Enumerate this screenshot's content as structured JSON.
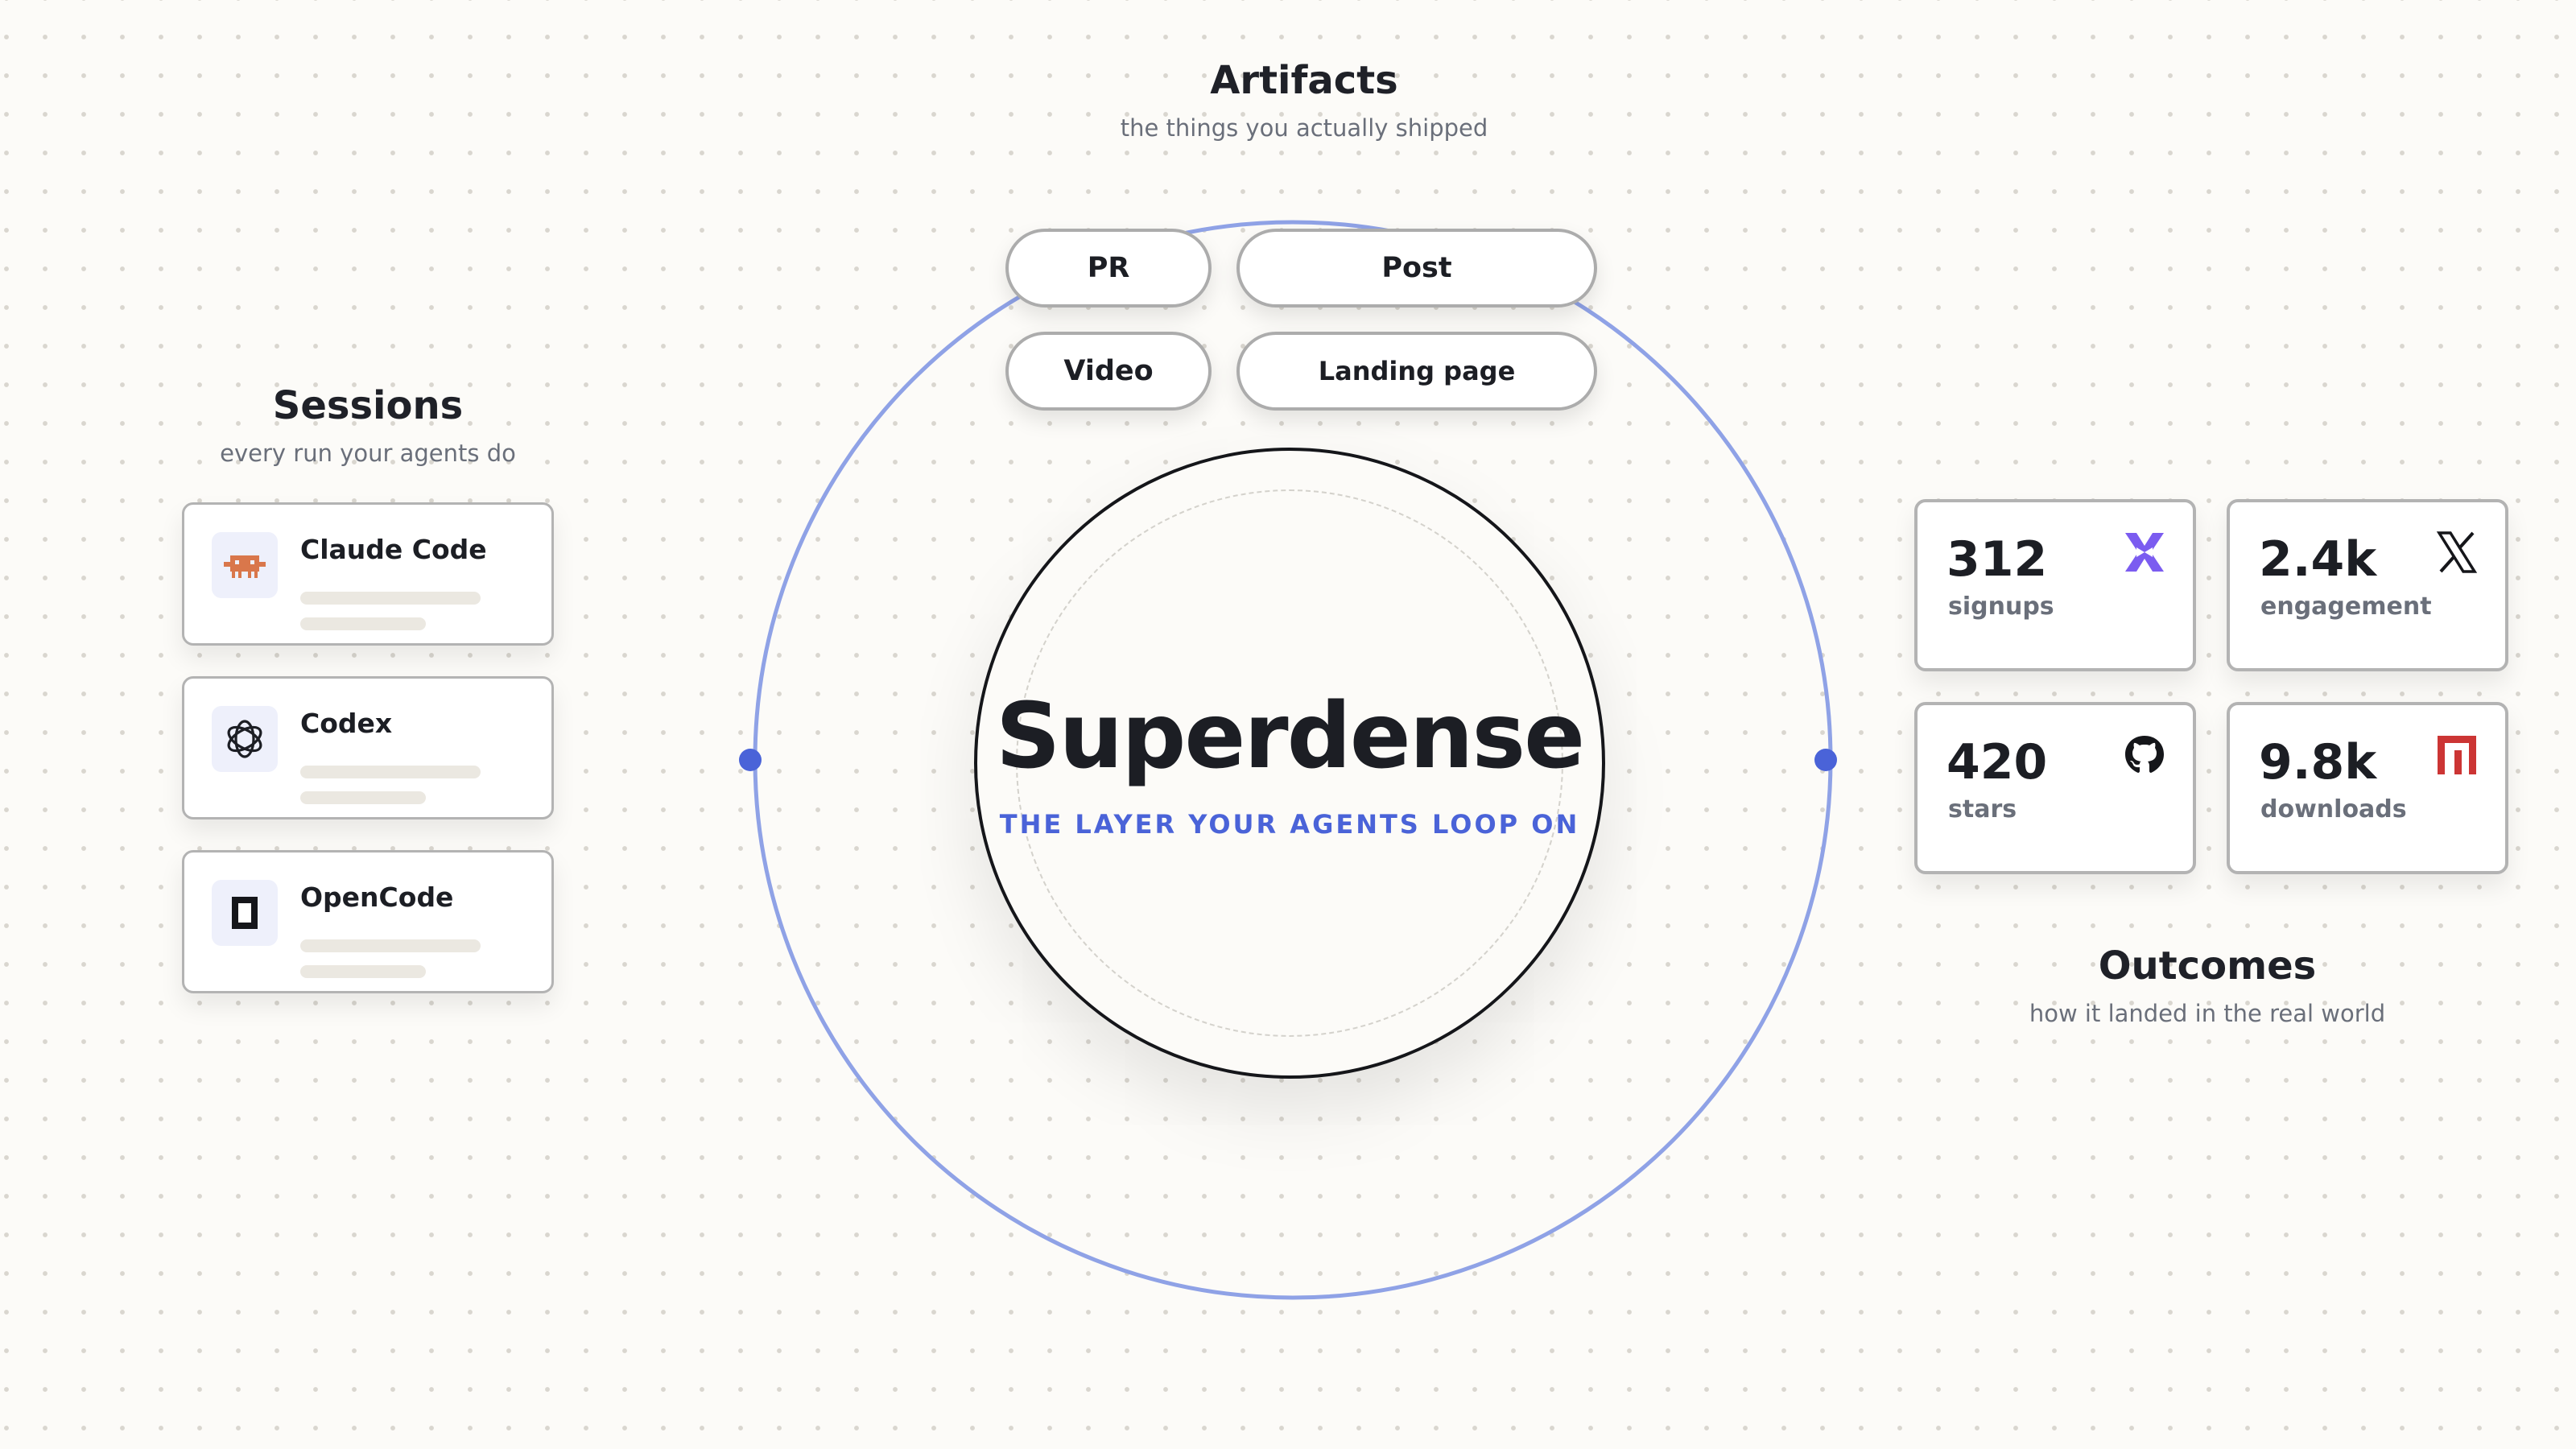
{
  "artifacts": {
    "title": "Artifacts",
    "subtitle": "the things you actually shipped",
    "items": [
      "PR",
      "Post",
      "Video",
      "Landing page"
    ]
  },
  "sessions": {
    "title": "Sessions",
    "subtitle": "every run your agents do",
    "items": [
      {
        "name": "Claude Code",
        "icon": "claude-code-icon"
      },
      {
        "name": "Codex",
        "icon": "openai-icon"
      },
      {
        "name": "OpenCode",
        "icon": "opencode-icon"
      }
    ]
  },
  "center": {
    "brand": "Superdense",
    "tagline": "THE LAYER YOUR AGENTS LOOP ON"
  },
  "outcomes": {
    "title": "Outcomes",
    "subtitle": "how it landed in the real world",
    "metrics": [
      {
        "value": "312",
        "label": "signups",
        "icon": "superdense-x-icon"
      },
      {
        "value": "2.4k",
        "label": "engagement",
        "icon": "x-twitter-icon"
      },
      {
        "value": "420",
        "label": "stars",
        "icon": "github-icon"
      },
      {
        "value": "9.8k",
        "label": "downloads",
        "icon": "npm-icon"
      }
    ]
  },
  "colors": {
    "accent": "#4a63d8",
    "ring": "#8fa2e6",
    "background": "#fcfbf8",
    "claude": "#d9774b",
    "npm": "#cc3534",
    "signups_icon": "#7b5cf0"
  }
}
